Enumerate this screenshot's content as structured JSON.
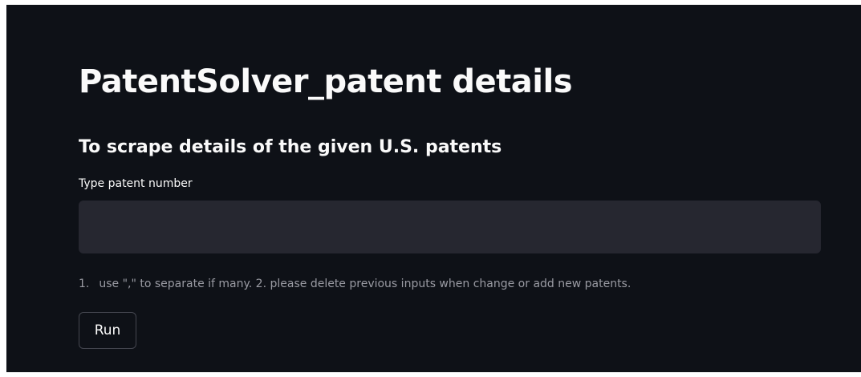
{
  "page": {
    "title": "PatentSolver_patent details",
    "subtitle": "To scrape details of the given U.S. patents"
  },
  "patent_input": {
    "label": "Type patent number",
    "value": "",
    "placeholder": ""
  },
  "help": {
    "number": "1.",
    "text": "use \",\" to separate if many. 2. please delete previous inputs when change or add new patents."
  },
  "run_button": {
    "label": "Run"
  },
  "colors": {
    "background": "#0e1117",
    "input_background": "#262730",
    "text": "#fafafa",
    "muted_text": "#9a9ba3",
    "button_border": "#44464f"
  }
}
